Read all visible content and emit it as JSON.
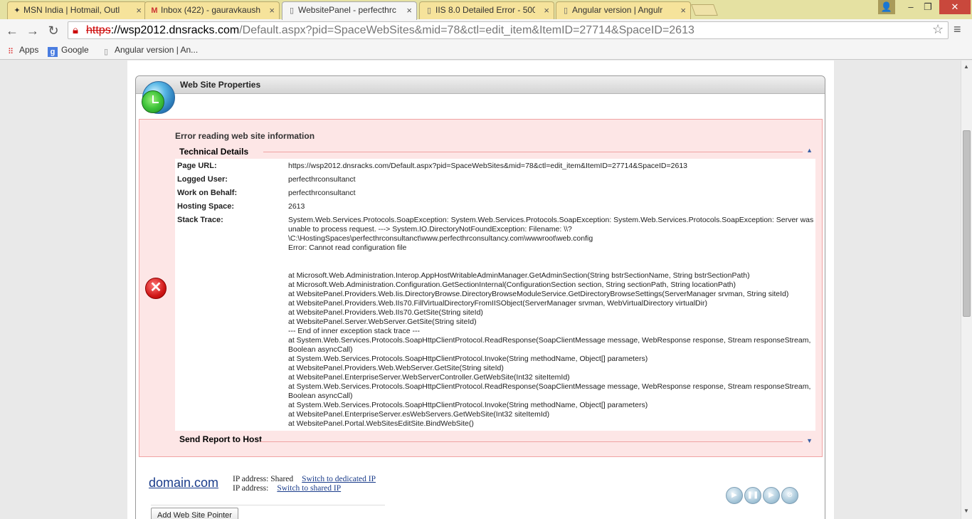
{
  "browser": {
    "tabs": [
      {
        "title": "MSN India | Hotmail, Outl",
        "favicon": "msn-icon"
      },
      {
        "title": "Inbox (422) - gauravkaush",
        "favicon": "gmail-icon"
      },
      {
        "title": "WebsitePanel - perfecthrc",
        "favicon": "page-icon"
      },
      {
        "title": "IIS 8.0 Detailed Error - 500",
        "favicon": "page-icon"
      },
      {
        "title": "Angular version | Angulr",
        "favicon": "page-icon"
      }
    ],
    "url": {
      "scheme": "https",
      "host": "://wsp2012.dnsracks.com",
      "path": "/Default.aspx?pid=SpaceWebSites&mid=78&ctl=edit_item&ItemID=27714&SpaceID=2613"
    },
    "bookmarks": [
      "Apps",
      "Google",
      "Angular version | An..."
    ]
  },
  "panel": {
    "title": "Web Site Properties"
  },
  "error": {
    "title": "Error reading web site information",
    "technical_details_label": "Technical Details",
    "send_report_label": "Send Report to Host",
    "fields": [
      {
        "label": "Page URL:",
        "value": "https://wsp2012.dnsracks.com/Default.aspx?pid=SpaceWebSites&mid=78&ctl=edit_item&ItemID=27714&SpaceID=2613"
      },
      {
        "label": "Logged User:",
        "value": "perfecthrconsultanct"
      },
      {
        "label": "Work on Behalf:",
        "value": "perfecthrconsultanct"
      },
      {
        "label": "Hosting Space:",
        "value": "2613"
      },
      {
        "label": "Stack Trace:",
        "value": "System.Web.Services.Protocols.SoapException: System.Web.Services.Protocols.SoapException: System.Web.Services.Protocols.SoapException: Server was unable to process request. ---> System.IO.DirectoryNotFoundException: Filename: \\\\?\\C:\\HostingSpaces\\perfecthrconsultanct\\www.perfecthrconsultancy.com\\wwwroot\\web.config\nError: Cannot read configuration file\n\n\nat Microsoft.Web.Administration.Interop.AppHostWritableAdminManager.GetAdminSection(String bstrSectionName, String bstrSectionPath)\nat Microsoft.Web.Administration.Configuration.GetSectionInternal(ConfigurationSection section, String sectionPath, String locationPath)\nat WebsitePanel.Providers.Web.Iis.DirectoryBrowse.DirectoryBrowseModuleService.GetDirectoryBrowseSettings(ServerManager srvman, String siteId)\nat WebsitePanel.Providers.Web.IIs70.FillVirtualDirectoryFromIISObject(ServerManager srvman, WebVirtualDirectory virtualDir)\nat WebsitePanel.Providers.Web.IIs70.GetSite(String siteId)\nat WebsitePanel.Server.WebServer.GetSite(String siteId)\n--- End of inner exception stack trace ---\nat System.Web.Services.Protocols.SoapHttpClientProtocol.ReadResponse(SoapClientMessage message, WebResponse response, Stream responseStream, Boolean asyncCall)\nat System.Web.Services.Protocols.SoapHttpClientProtocol.Invoke(String methodName, Object[] parameters)\nat WebsitePanel.Providers.Web.WebServer.GetSite(String siteId)\nat WebsitePanel.EnterpriseServer.WebServerController.GetWebSite(Int32 siteItemId)\nat System.Web.Services.Protocols.SoapHttpClientProtocol.ReadResponse(SoapClientMessage message, WebResponse response, Stream responseStream, Boolean asyncCall)\nat System.Web.Services.Protocols.SoapHttpClientProtocol.Invoke(String methodName, Object[] parameters)\nat WebsitePanel.EnterpriseServer.esWebServers.GetWebSite(Int32 siteItemId)\nat WebsitePanel.Portal.WebSitesEditSite.BindWebSite()"
      }
    ]
  },
  "site": {
    "domain": "domain.com",
    "ip_line1_label": "IP address: Shared",
    "ip_line1_link": "Switch to dedicated IP",
    "ip_line2_label": "IP address:",
    "ip_line2_link": "Switch to shared IP",
    "add_pointer_label": "Add Web Site Pointer"
  }
}
